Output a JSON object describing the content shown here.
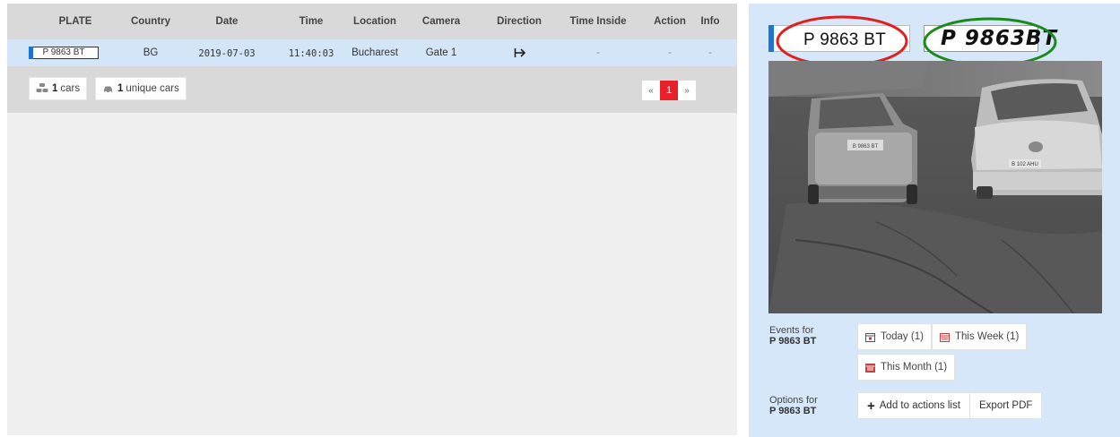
{
  "table": {
    "headers": [
      "PLATE",
      "Country",
      "Date",
      "Time",
      "Location",
      "Camera",
      "Direction",
      "Time Inside",
      "Action",
      "Info"
    ],
    "rows": [
      {
        "plate": "P 9863 BT",
        "country": "BG",
        "date": "2019-07-03",
        "time": "11:40:03",
        "location": "Bucharest",
        "camera": "Gate 1",
        "direction_icon": "arrow-right-icon",
        "time_inside": "-",
        "action": "-",
        "info": "-"
      }
    ]
  },
  "footer": {
    "cars_count": "1",
    "cars_label": "cars",
    "unique_count": "1",
    "unique_label": "unique cars"
  },
  "pagination": {
    "first": "«",
    "current": "1",
    "last": "»"
  },
  "detail": {
    "plate_text": "P 9863 BT",
    "plate_image_text": "P 9863BT",
    "events_for_label": "Events for",
    "events_plate": "P 9863 BT",
    "event_buttons": [
      "Today (1)",
      "This Week (1)",
      "This Month (1)"
    ],
    "options_for_label": "Options for",
    "options_plate": "P 9863 BT",
    "add_actions_label": "Add to actions list",
    "export_pdf_label": "Export PDF",
    "camera_plate_left": "B 9863 BT",
    "camera_plate_right": "B 102 AHU"
  },
  "colors": {
    "accent_blue": "#1e73d8",
    "page_active_red": "#e8202a",
    "red_ellipse": "#e02020",
    "green_ellipse": "#1a8a1a"
  }
}
